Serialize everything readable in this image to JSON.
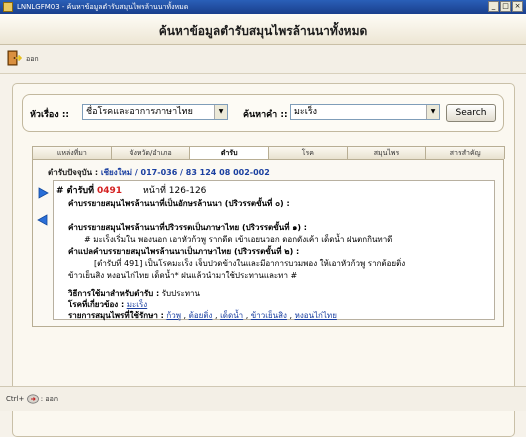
{
  "window": {
    "title": "LNNLGFM03 - ค้นหาข้อมูลตำรับสมุนไพรล้านนาทั้งหมด",
    "min_label": "_",
    "max_label": "□",
    "close_label": "×"
  },
  "header": {
    "title": "ค้นหาข้อมูลตำรับสมุนไพรล้านนาทั้งหมด"
  },
  "toolbar": {
    "exit_label": "ออก"
  },
  "search": {
    "topic_label": "หัวเรื่อง ::",
    "topic_value": "ชื่อโรคและอาการภาษาไทย",
    "keyword_label": "ค้นหาคำ ::",
    "keyword_value": "มะเร็ง",
    "button_label": "Search"
  },
  "tabs": [
    {
      "label": "แหล่งที่มา",
      "active": false
    },
    {
      "label": "จังหวัด/อำเภอ",
      "active": false
    },
    {
      "label": "ตำรับ",
      "active": true
    },
    {
      "label": "โรค",
      "active": false
    },
    {
      "label": "สมุนไพร",
      "active": false
    },
    {
      "label": "สารสำคัญ",
      "active": false
    }
  ],
  "record": {
    "path_label": "ตำรับปัจจุบัน :",
    "path_value": "เชียงใหม่ / 017-036 / 83 124 08 002-002",
    "number_label": "# ตำรับที่",
    "number_value": "0491",
    "page_label": "หน้าที่ 126-126",
    "lanna_line": "คำบรรยายสมุนไพรล้านนาที่เป็นอักษรล้านนา (ปริวรรตขั้นที่ ๐) :",
    "thai1_heading": "คำบรรยายสมุนไพรล้านนาที่ปริวรรตเป็นภาษาไทย (ปริวรรตขั้นที่ ๑) :",
    "thai1_text": "# มะเร็งเริ่มใน พองนอก เอาหัวก้วพู รากดีด เข้าเอยนวอก ดอกดังเค้า เด็ดน้ำ ฝนตกกินทาดี",
    "thai2_heading": "คำแปลคำบรรยายสมุนไพรล้านนาเป็นภาษาไทย (ปริวรรตขั้นที่ ๒) :",
    "thai2_text1": "[ตำรับที่ 491] เป็นโรคมะเร็ง เจ็บปวดข้างในและมีอาการบวมพอง ให้เอาหัวก้วพู รากต้อยติ่ง",
    "thai2_text2": "ข้าวเย็นสิง หงอนไก่ไทย เด็ดน้ำ* ฝนแล้วนำมาใช้ประทานและทา #",
    "usage_label": "วิธีการใช้มาสำหรับตำรับ :",
    "usage_value": "รับประทาน",
    "disease_label": "โรคที่เกี่ยวข้อง :",
    "disease_value": "มะเร็ง",
    "herbs_label": "รายการสมุนไพรที่ใช้รักษา :",
    "herbs": [
      "ก้วพู",
      "ต้อยติ่ง",
      "เด็ดน้ำ",
      "ข้าวเย็นสิง",
      "หงอนไก่ไทย"
    ]
  },
  "footer": {
    "shortcut_prefix": "Ctrl+",
    "shortcut_suffix": ": ออก"
  },
  "colors": {
    "titlebar": "#1a3f8c",
    "path_value": "#1a3fa0",
    "record_number": "#d42020",
    "nav_arrow": "#2a6fd8"
  }
}
